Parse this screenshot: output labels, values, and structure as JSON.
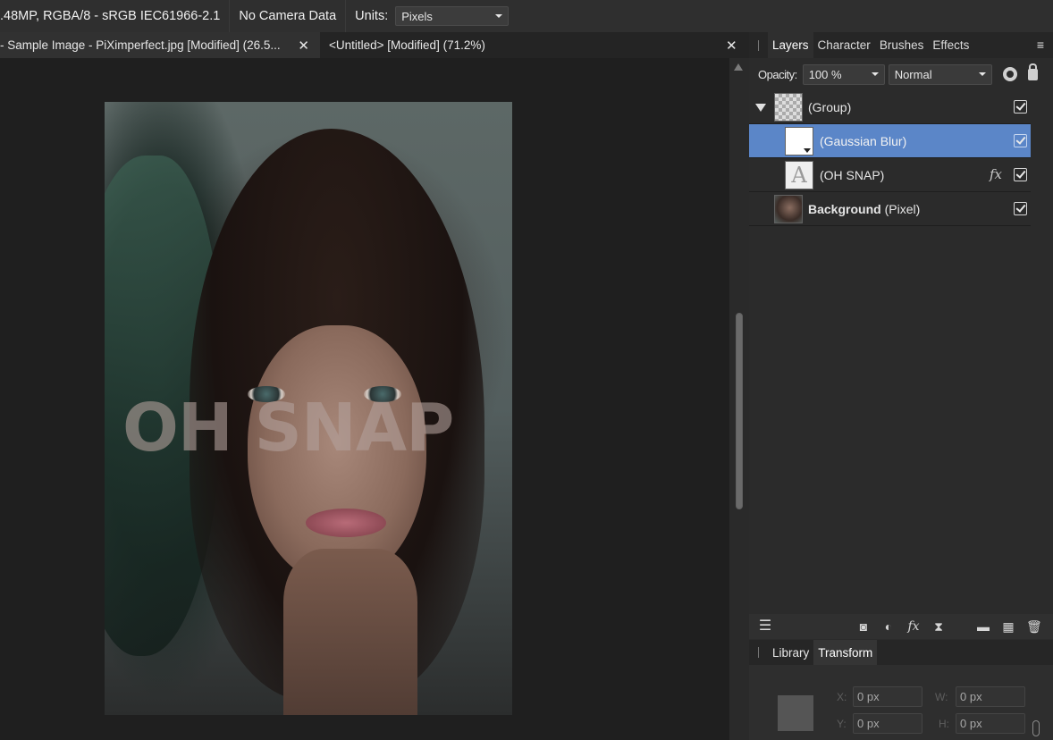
{
  "context_bar": {
    "image_info": ".48MP, RGBA/8 - sRGB IEC61966-2.1",
    "camera_info": "No Camera Data",
    "units_label": "Units:",
    "units_value": "Pixels"
  },
  "document_tabs": [
    {
      "label": "- Sample Image - PiXimperfect.jpg [Modified] (26.5...",
      "active": true
    },
    {
      "label": "<Untitled> [Modified] (71.2%)",
      "active": false
    }
  ],
  "canvas": {
    "overlay_text": "OH SNAP"
  },
  "panel": {
    "tabs": [
      "Layers",
      "Character",
      "Brushes",
      "Effects"
    ],
    "active_tab": "Layers",
    "opacity_label": "Opacity:",
    "opacity_value": "100 %",
    "blend_mode": "Normal",
    "layers": [
      {
        "name": "(Group)",
        "expanded": true,
        "visible": true
      },
      {
        "name": "(Gaussian Blur)",
        "selected": true,
        "visible": true
      },
      {
        "name": "(OH SNAP)",
        "fx": "fx",
        "visible": true
      },
      {
        "name_bold": "Background",
        "name_suffix": " (Pixel)",
        "visible": true
      }
    ]
  },
  "lower_panel": {
    "tabs": [
      "Library",
      "Transform"
    ],
    "active_tab": "Transform",
    "x_label": "X:",
    "y_label": "Y:",
    "w_label": "W:",
    "h_label": "H:",
    "x_value": "0 px",
    "y_value": "0 px",
    "w_value": "0 px",
    "h_value": "0 px"
  },
  "colors": {
    "selection": "#5b86c8",
    "panel_bg": "#2b2b2b",
    "canvas_bg": "#1f1f1f"
  }
}
